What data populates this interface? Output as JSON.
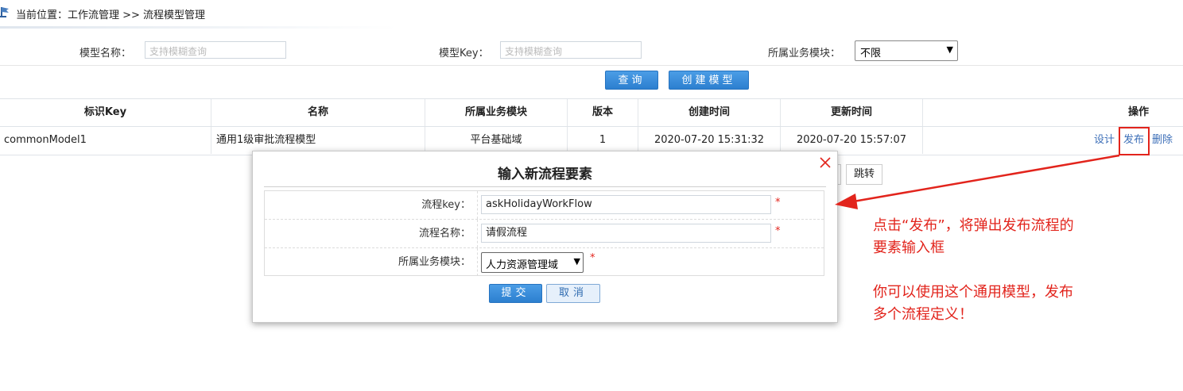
{
  "breadcrumb": {
    "text": "当前位置：工作流管理 >> 流程模型管理"
  },
  "search": {
    "model_name_label": "模型名称：",
    "model_name_placeholder": "支持模糊查询",
    "model_key_label": "模型Key：",
    "model_key_placeholder": "支持模糊查询",
    "module_label": "所属业务模块：",
    "module_value": "不限",
    "query_button": "查询",
    "create_button": "创建模型"
  },
  "table": {
    "headers": [
      "标识Key",
      "名称",
      "所属业务模块",
      "版本",
      "创建时间",
      "更新时间",
      "操作"
    ],
    "rows": [
      {
        "key": "commonModel1",
        "name": "通用1级审批流程模型",
        "module": "平台基础域",
        "version": "1",
        "created": "2020-07-20 15:31:32",
        "updated": "2020-07-20 15:57:07",
        "actions": [
          "设计",
          "发布",
          "删除"
        ]
      }
    ]
  },
  "pagination": {
    "jump_button": "跳转"
  },
  "dialog": {
    "title": "输入新流程要素",
    "fields": [
      {
        "label": "流程key：",
        "value": "askHolidayWorkFlow"
      },
      {
        "label": "流程名称：",
        "value": "请假流程"
      },
      {
        "label": "所属业务模块：",
        "value": "人力资源管理域"
      }
    ],
    "required_mark": "*",
    "submit_button": "提交",
    "cancel_button": "取消"
  },
  "annotation": {
    "line1": "点击“发布”，将弹出发布流程的",
    "line2": "要素输入框",
    "line3": "你可以使用这个通用模型，发布",
    "line4": "多个流程定义！",
    "color": "#e2241c"
  }
}
